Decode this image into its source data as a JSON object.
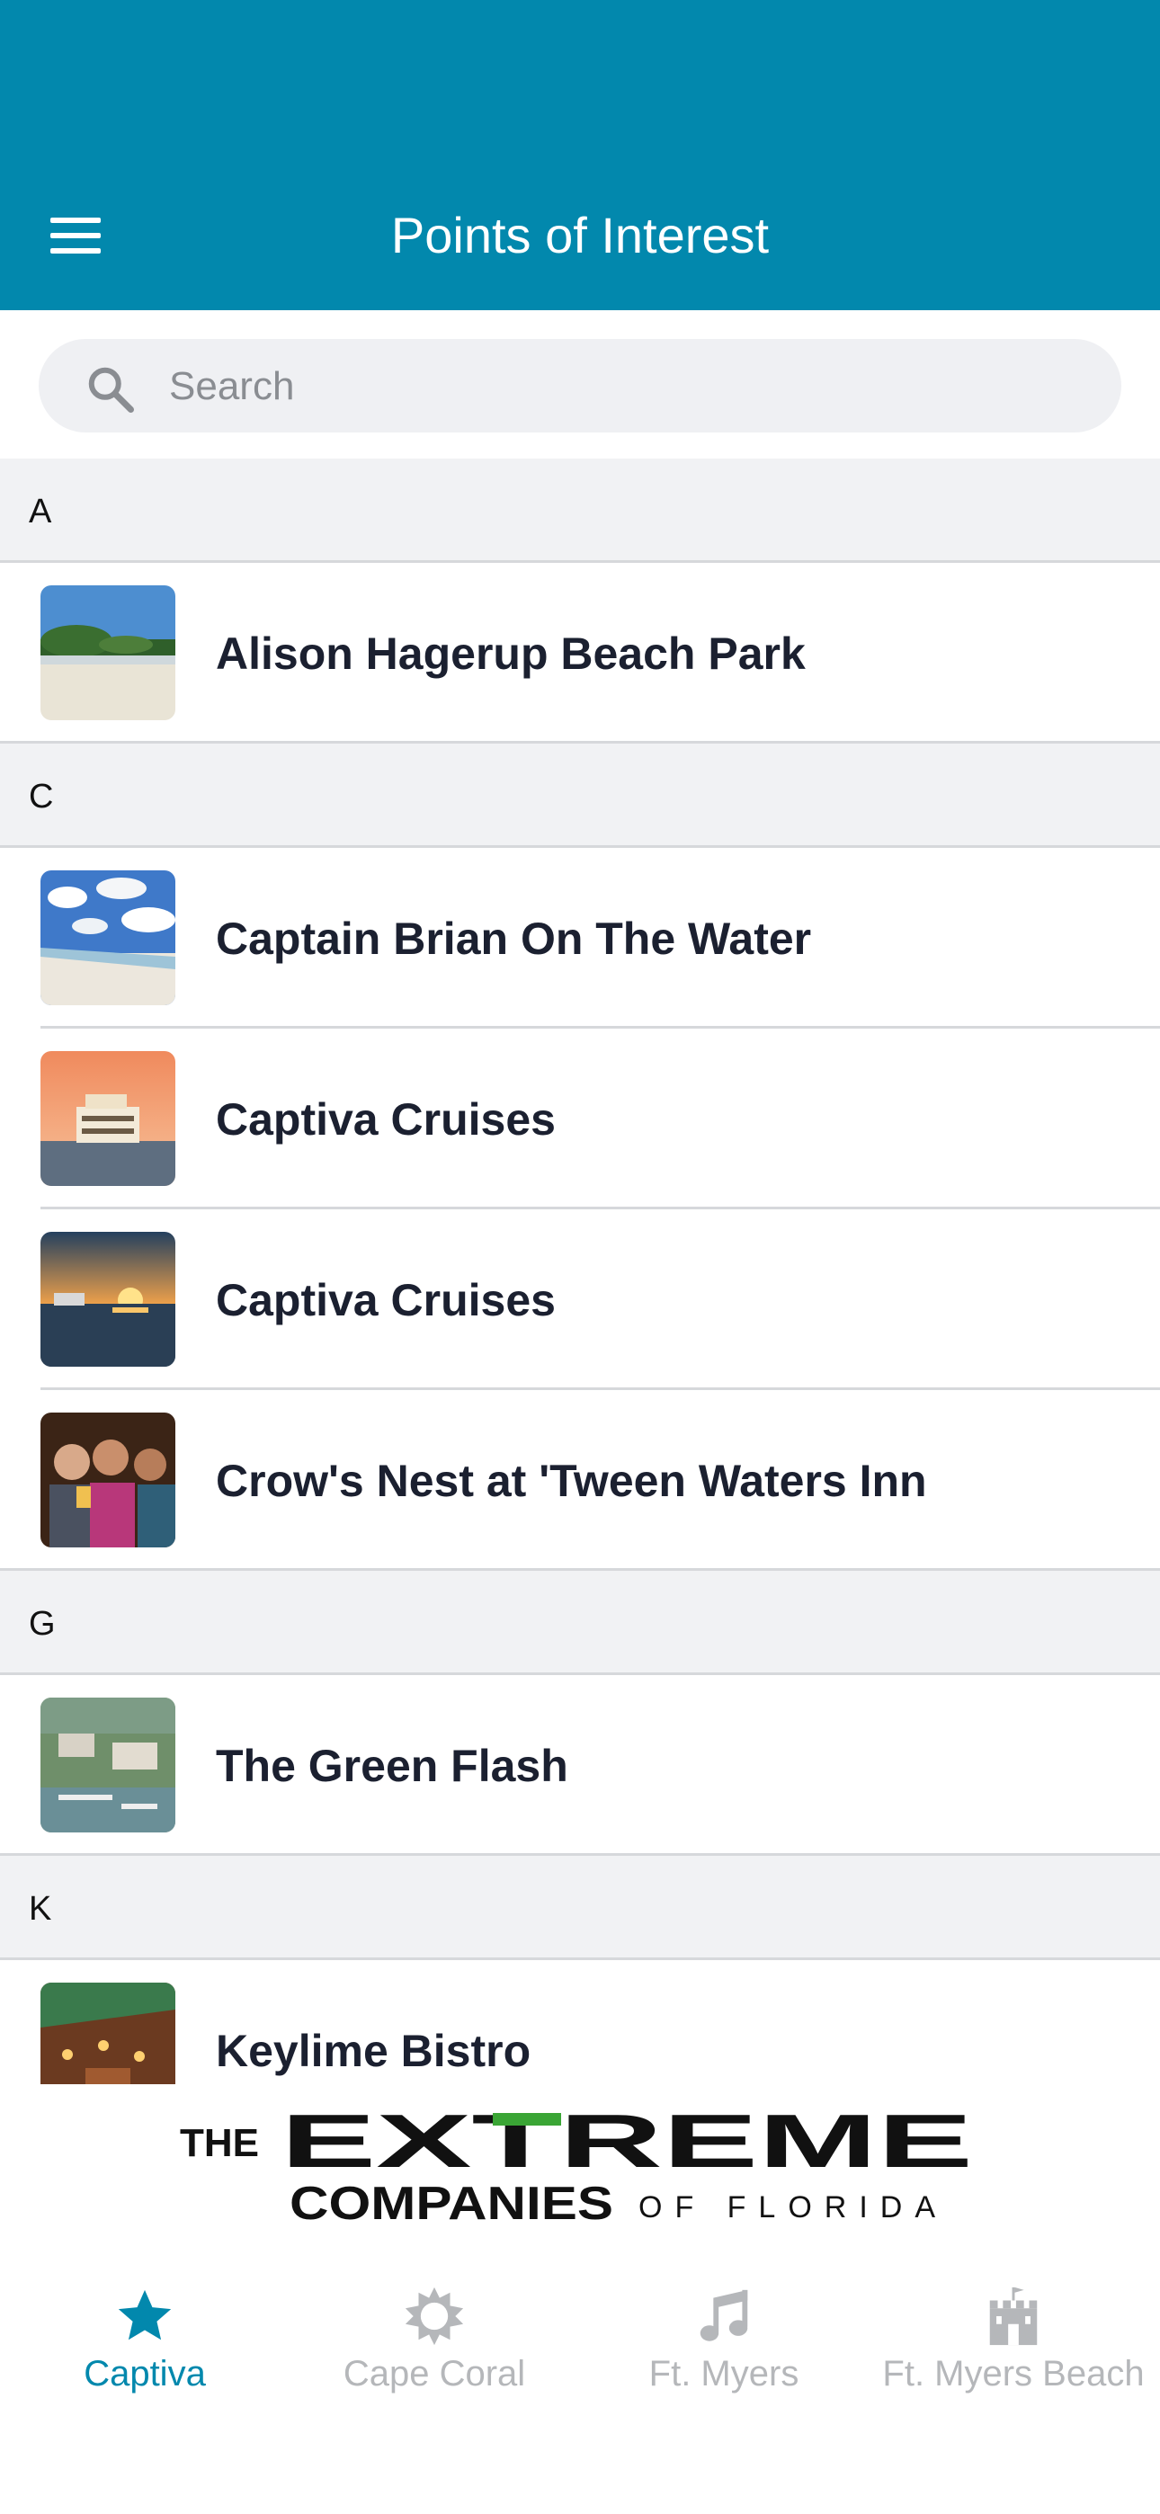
{
  "header": {
    "title": "Points of Interest",
    "menu_icon": "hamburger-menu-icon",
    "color": "#0288ad"
  },
  "search": {
    "placeholder": "Search",
    "icon": "search-icon"
  },
  "sections": [
    {
      "letter": "A",
      "items": [
        {
          "name": "Alison Hagerup Beach Park",
          "thumb": "beach-photo"
        }
      ]
    },
    {
      "letter": "C",
      "items": [
        {
          "name": "Captain Brian On The Water",
          "thumb": "beach-sky-photo"
        },
        {
          "name": "Captiva Cruises",
          "thumb": "cruise-boat-sunset-photo"
        },
        {
          "name": "Captiva Cruises",
          "thumb": "boat-sunset-photo"
        },
        {
          "name": "Crow's Nest at 'Tween Waters Inn",
          "thumb": "people-toasting-photo"
        }
      ]
    },
    {
      "letter": "G",
      "items": [
        {
          "name": "The Green Flash",
          "thumb": "aerial-marina-photo"
        }
      ]
    },
    {
      "letter": "K",
      "items": [
        {
          "name": "Keylime Bistro",
          "thumb": "restaurant-photo"
        }
      ]
    }
  ],
  "sponsor": {
    "line1_prefix": "THE",
    "line1_main": "EXTREME",
    "line2_main": "COMPANIES",
    "line2_suffix": "OF FLORIDA"
  },
  "tabs": [
    {
      "label": "Captiva",
      "icon": "star-icon",
      "active": true
    },
    {
      "label": "Cape Coral",
      "icon": "sun-icon",
      "active": false
    },
    {
      "label": "Ft. Myers",
      "icon": "music-note-icon",
      "active": false
    },
    {
      "label": "Ft. Myers Beach",
      "icon": "castle-icon",
      "active": false
    }
  ],
  "colors": {
    "accent": "#0288ad",
    "tab_inactive": "#b5b7ba",
    "logo_green": "#3aa535"
  }
}
